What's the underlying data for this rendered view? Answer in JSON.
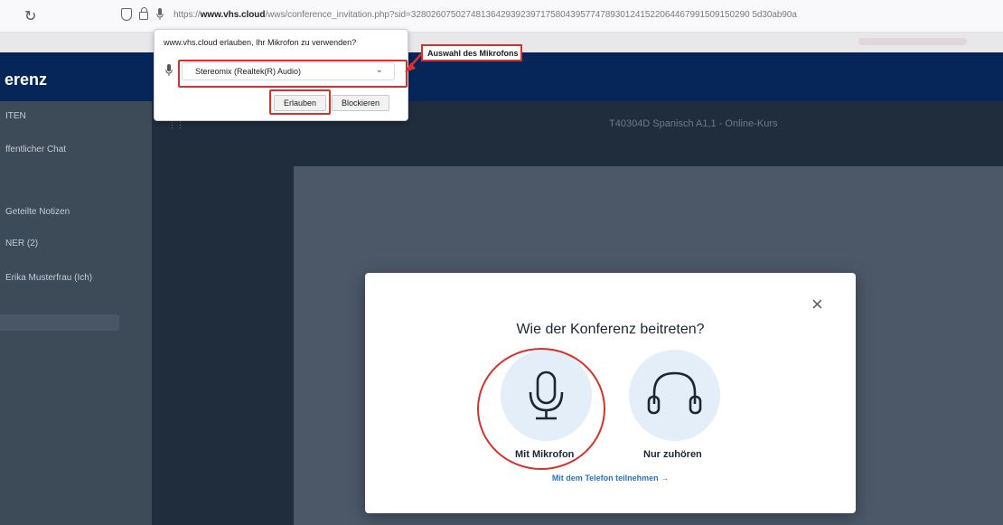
{
  "browser": {
    "url_host": "www.vhs.cloud",
    "url_prefix": "https://",
    "url_path": "/wws/conference_invitation.php?sid=32802607502748136429392397175804395774789301241522064467991509150290 5d30ab90a"
  },
  "app": {
    "title_partial": "erenz",
    "course_title": "T40304D Spanisch A1,1 - Online-Kurs"
  },
  "sidebar": {
    "items": [
      {
        "label": "ITEN"
      },
      {
        "label": "ffentlicher Chat"
      },
      {
        "label": "Geteilte Notizen"
      },
      {
        "label": "NER (2)"
      },
      {
        "label": "Erika Musterfrau (Ich)"
      }
    ]
  },
  "permission": {
    "prompt": "www.vhs.cloud erlauben, Ihr Mikrofon zu verwenden?",
    "selected_device": "Stereomix (Realtek(R) Audio)",
    "allow_label": "Erlauben",
    "block_label": "Blockieren"
  },
  "callout": {
    "label": "Auswahl des Mikrofons"
  },
  "join_modal": {
    "title": "Wie der Konferenz beitreten?",
    "mic_label": "Mit Mikrofon",
    "listen_label": "Nur zuhören",
    "phone_link": "Mit dem Telefon teilnehmen →",
    "close": "×"
  },
  "colors": {
    "header_navy": "#06265a",
    "annotation_red": "#d9302c",
    "link_blue": "#2a73c9"
  }
}
